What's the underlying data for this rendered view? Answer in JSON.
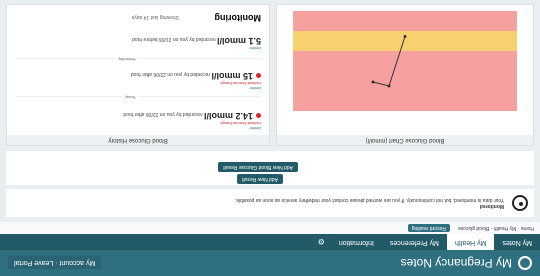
{
  "header": {
    "title": "My Pregnancy Notes",
    "account_label": "My account · Leave Portal"
  },
  "nav": {
    "tabs": [
      "My Notes",
      "My Health",
      "My Preferences",
      "Information"
    ]
  },
  "crumb": {
    "text": "Home · My Health · Blood glucose",
    "button": "Record reading"
  },
  "notice": {
    "title": "Monitored",
    "text": "Your data is monitored, but not continuously. If you are worried please contact your midwifery service as soon as possible."
  },
  "actions": {
    "add_button": "Add New Blood Glucose Result",
    "add_more": "Add New Result"
  },
  "panels": {
    "left_title": "Blood Glucose History",
    "right_title": "Blood Glucose Chart (mmol/l)",
    "group_title": "Monitoring",
    "group_sub": "Showing last 14 days",
    "readings": [
      {
        "value": "14.2 mmol/l",
        "desc": "recorded by you on 22/06 after food",
        "tag": "Outside Normal Range",
        "link": "Delete"
      },
      {
        "value": "15 mmol/l",
        "desc": "recorded by you on 22/06 after food",
        "tag": "Outside Normal Range",
        "link": "Delete"
      },
      {
        "value": "5.1 mmol/l",
        "desc": "recorded by you on 21/06 before food",
        "tag": "",
        "link": "Delete"
      }
    ],
    "separators": [
      "Today",
      "Yesterday"
    ]
  },
  "chart_data": {
    "type": "line",
    "title": "",
    "ylim": [
      0,
      20
    ],
    "bands": [
      {
        "from": 0,
        "to": 4,
        "color": "#f6a0a0"
      },
      {
        "from": 4,
        "to": 8,
        "color": "#f7d070"
      },
      {
        "from": 8,
        "to": 12,
        "color": "#f6a0a0"
      },
      {
        "from": 12,
        "to": 20,
        "color": "#f6a0a0"
      }
    ],
    "series": [
      {
        "values": [
          5.1,
          15,
          14.2
        ]
      }
    ]
  }
}
